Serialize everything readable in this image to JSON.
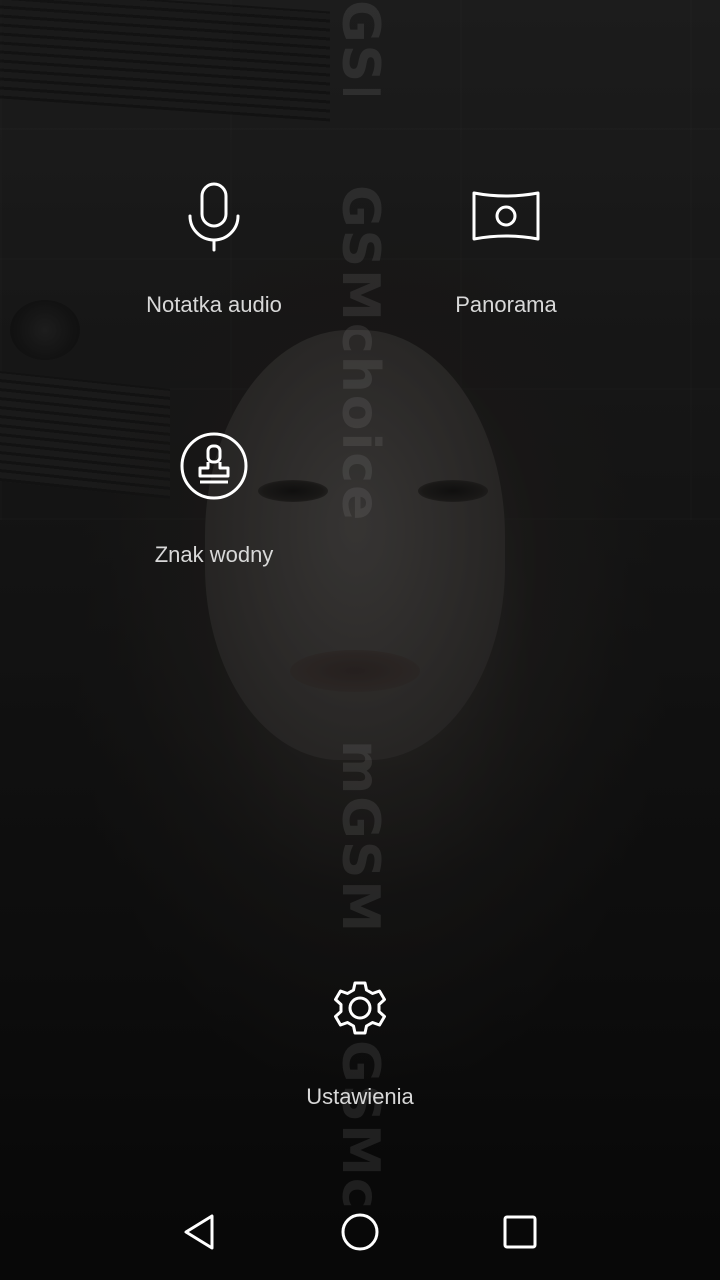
{
  "menu": {
    "items": [
      {
        "id": "audio_note",
        "label": "Notatka audio",
        "icon": "microphone-icon"
      },
      {
        "id": "panorama",
        "label": "Panorama",
        "icon": "panorama-icon"
      },
      {
        "id": "watermark",
        "label": "Znak wodny",
        "icon": "stamp-icon"
      },
      {
        "id": "settings",
        "label": "Ustawienia",
        "icon": "gear-icon"
      }
    ]
  },
  "watermark_text": {
    "top": "GSM",
    "middle": "GSMchoice",
    "lower": "mGSM",
    "bottom": "GSMc"
  },
  "navbar": {
    "back_icon": "back-triangle-icon",
    "home_icon": "home-circle-icon",
    "recents_icon": "recents-square-icon"
  },
  "colors": {
    "icon_stroke": "#ffffff",
    "label": "#d8d8d8"
  }
}
